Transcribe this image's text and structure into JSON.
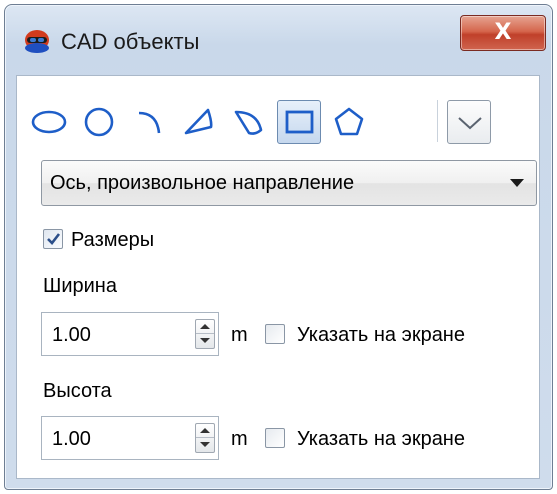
{
  "window": {
    "title": "CAD объекты",
    "close_label": "X"
  },
  "toolbar": {
    "tools": [
      "ellipse-icon",
      "circle-icon",
      "arc-icon",
      "kite-icon",
      "segment-icon",
      "rectangle-icon",
      "pentagon-icon"
    ],
    "active_tool": "rectangle-icon",
    "more_icon": "chevron-down-icon"
  },
  "axis_select": {
    "value": "Ось, произвольное направление"
  },
  "dimensions": {
    "label": "Размеры",
    "checked": true
  },
  "width": {
    "label": "Ширина",
    "value": "1.00",
    "unit": "m",
    "pick_label": "Указать на экране",
    "pick_checked": false
  },
  "height": {
    "label": "Высота",
    "value": "1.00",
    "unit": "m",
    "pick_label": "Указать на экране",
    "pick_checked": false
  },
  "colors": {
    "icon_blue": "#1e5ec8",
    "close_red": "#c8452e",
    "panel_bg": "#cfdcec"
  }
}
